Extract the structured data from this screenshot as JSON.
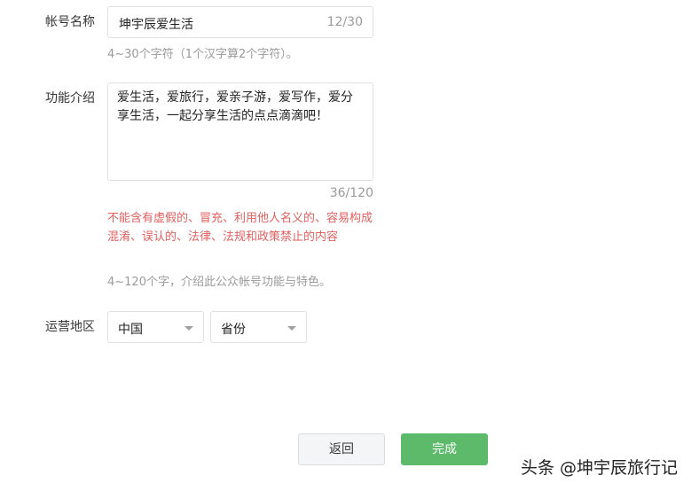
{
  "account_name": {
    "label": "帐号名称",
    "value": "坤宇辰爱生活",
    "counter": "12/30",
    "hint": "4~30个字符（1个汉字算2个字符）。"
  },
  "intro": {
    "label": "功能介绍",
    "value": "爱生活，爱旅行，爱亲子游，爱写作，爱分享生活，一起分享生活的点点滴滴吧！",
    "counter": "36/120",
    "error": "不能含有虚假的、冒充、利用他人名义的、容易构成混淆、误认的、法律、法规和政策禁止的内容",
    "hint": "4~120个字，介绍此公众帐号功能与特色。"
  },
  "region": {
    "label": "运营地区",
    "country": "中国",
    "province_placeholder": "省份"
  },
  "actions": {
    "back_label": "返回",
    "done_label": "完成"
  },
  "watermark": "头条 @坤宇辰旅行记",
  "colors": {
    "accent": "#5cba6a",
    "error": "#e15f5f",
    "hint": "#9a9a9a"
  }
}
